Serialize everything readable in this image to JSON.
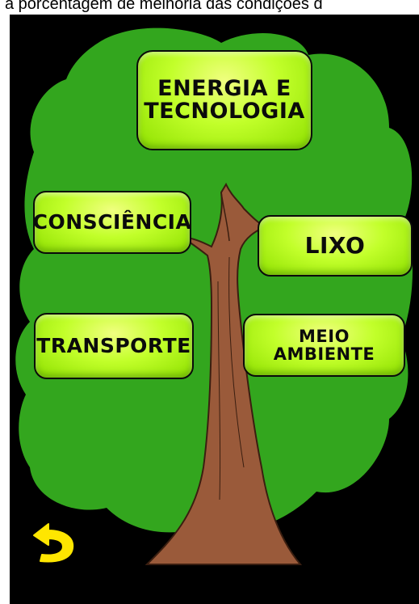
{
  "header": {
    "scrolling_text": "a porcentagem de melhoria das condições d"
  },
  "menu": {
    "energia": "ENERGIA E\nTECNOLOGIA",
    "consciencia": "CONSCIÊNCIA",
    "lixo": "LIXO",
    "transporte": "TRANSPORTE",
    "meio_ambiente": "MEIO\nAMBIENTE"
  },
  "icons": {
    "back": "back-arrow-icon",
    "tree": "tree-illustration"
  },
  "colors": {
    "background": "#000000",
    "foliage": "#33a61e",
    "trunk": "#9a5a3a",
    "button": "#c2ff2a",
    "back_arrow": "#ffe600"
  }
}
